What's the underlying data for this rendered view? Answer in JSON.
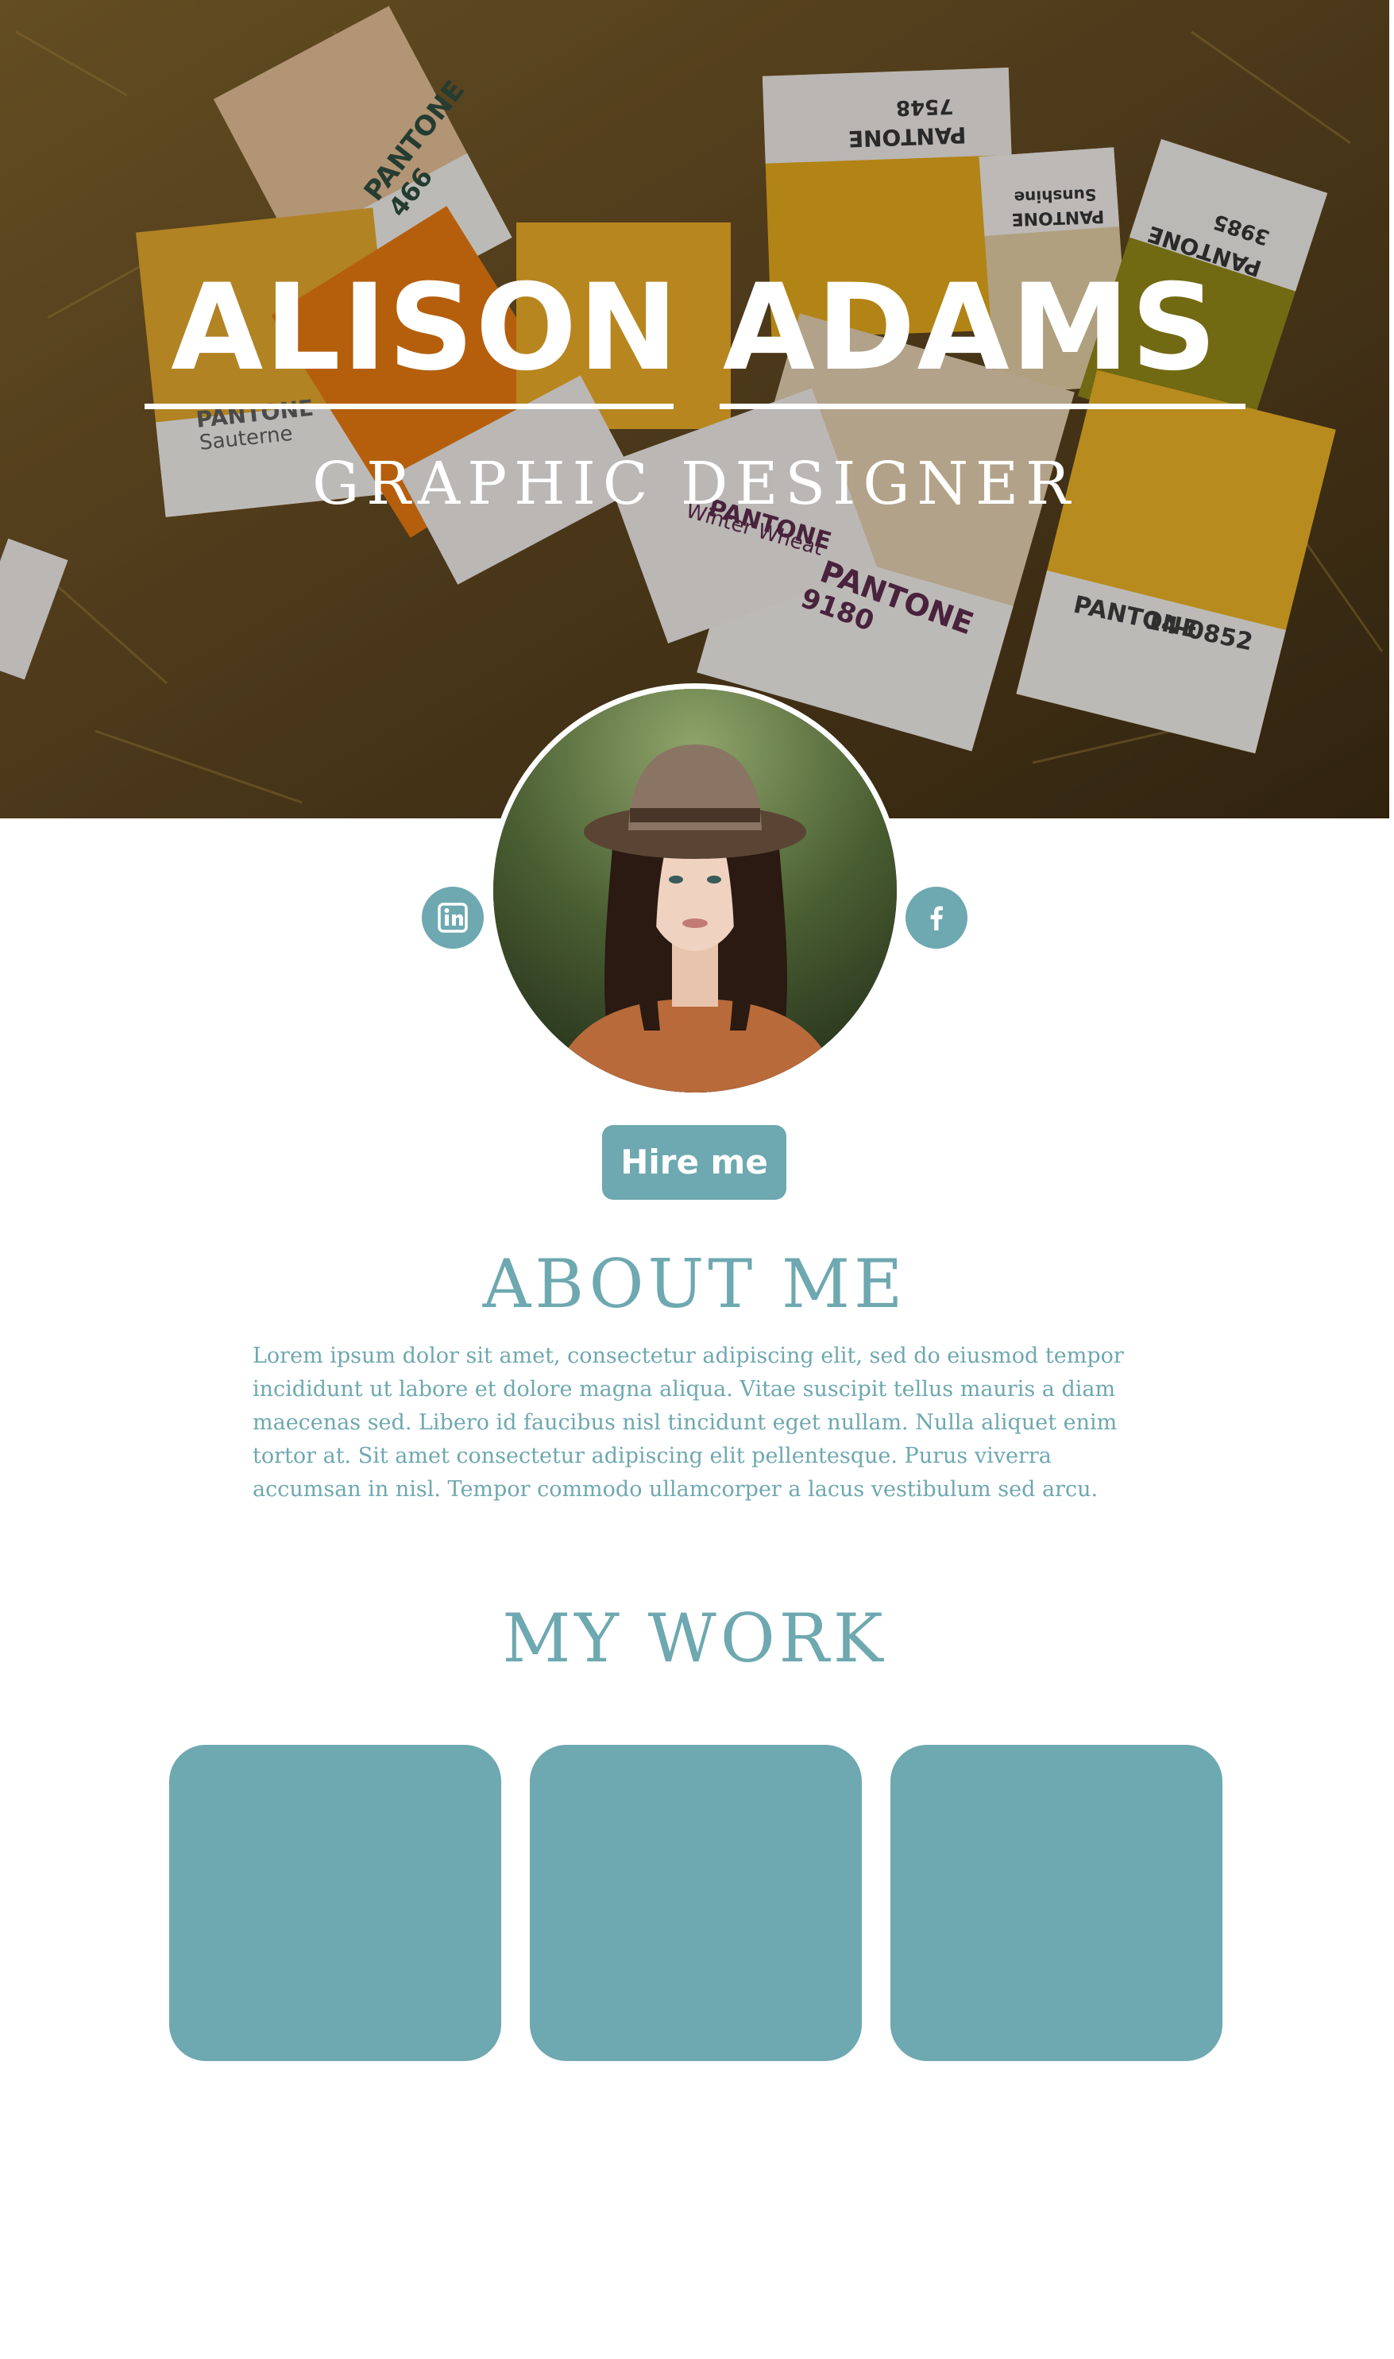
{
  "hero": {
    "name": "ALISON ADAMS",
    "role": "GRAPHIC DESIGNER",
    "swatches": [
      {
        "brand": "PANTONE",
        "code": "466"
      },
      {
        "brand": "PANTONE",
        "code": "7548"
      },
      {
        "brand": "PANTONE",
        "code": "Sunshine"
      },
      {
        "brand": "PANTONE",
        "code": "3985"
      },
      {
        "brand": "PANTONE",
        "code": "Sauterne"
      },
      {
        "brand": "PANTONE",
        "code": "Winter Wheat"
      },
      {
        "brand": "PANTONE",
        "code": "9180"
      },
      {
        "brand": "PANTONE",
        "code": "14-0852"
      }
    ]
  },
  "profile": {
    "social": [
      {
        "network": "LinkedIn",
        "icon": "linkedin-icon",
        "glyph": "in"
      },
      {
        "network": "Facebook",
        "icon": "facebook-icon",
        "glyph": "f"
      }
    ],
    "hire_label": "Hire me"
  },
  "about": {
    "heading": "ABOUT ME",
    "body": "Lorem ipsum dolor sit amet, consectetur adipiscing elit, sed do eiusmod tempor incididunt ut labore et dolore magna aliqua. Vitae suscipit tellus mauris a diam maecenas sed. Libero id faucibus nisl tincidunt eget nullam. Nulla aliquet enim tortor at. Sit amet consectetur adipiscing elit pellentesque. Purus viverra accumsan in nisl. Tempor commodo ullamcorper a lacus vestibulum sed arcu."
  },
  "work": {
    "heading": "MY WORK",
    "tiles": 3
  },
  "colors": {
    "accent": "#6ea8b0",
    "background": "#ffffff",
    "hero_text": "#ffffff"
  }
}
